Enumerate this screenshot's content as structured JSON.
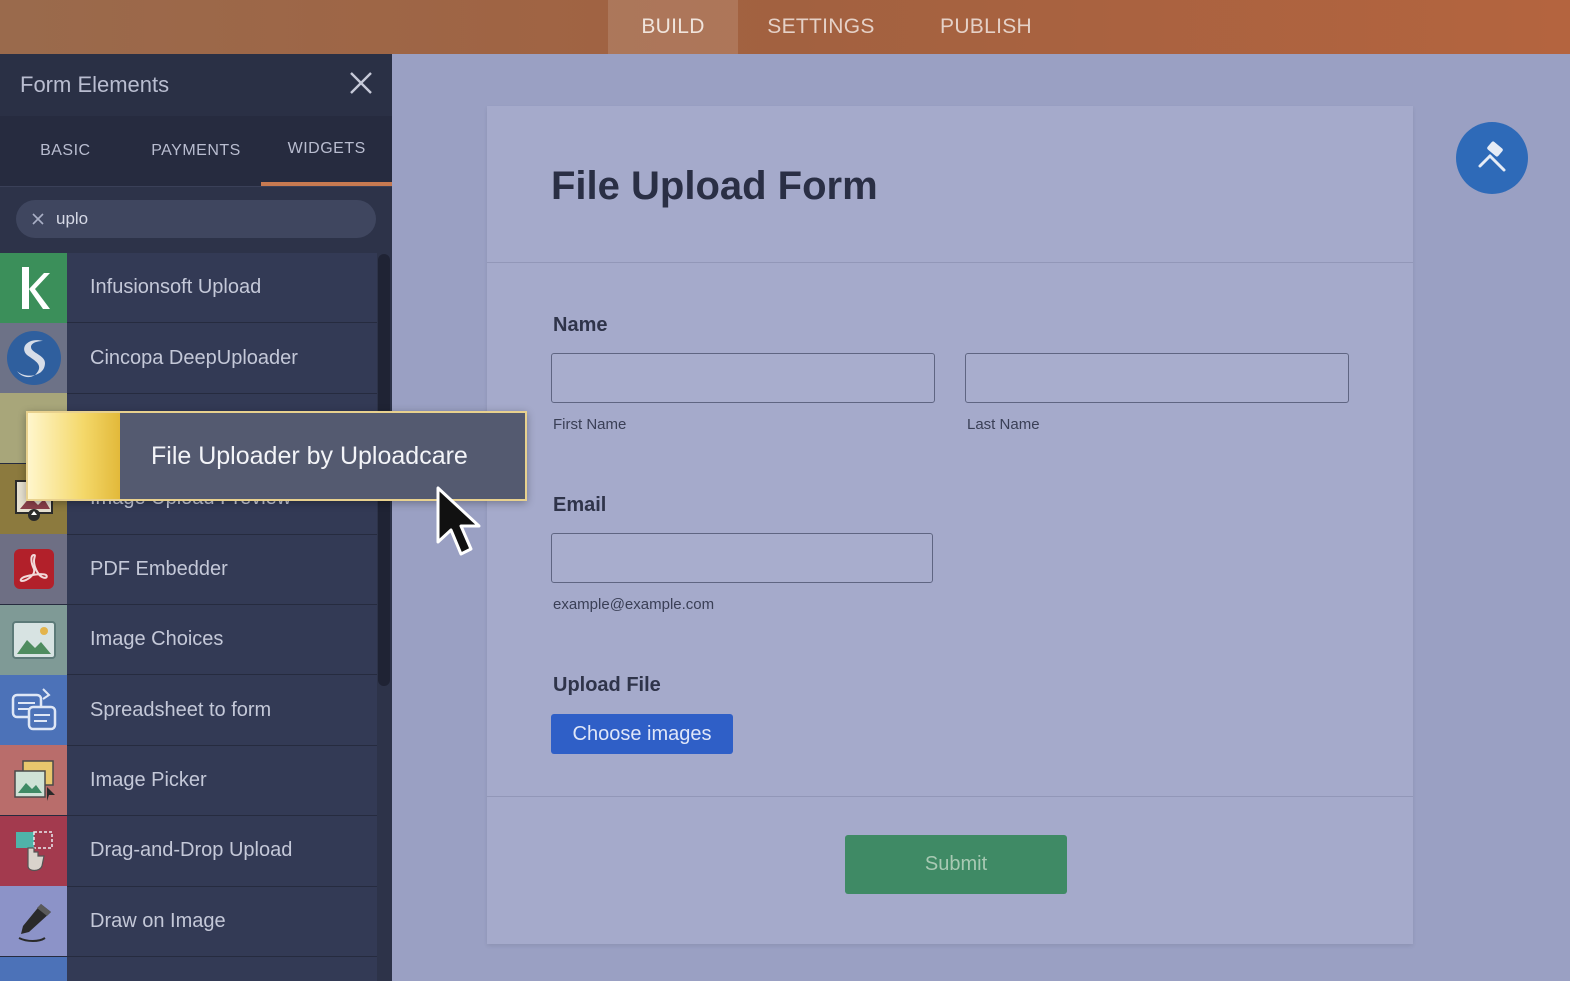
{
  "topnav": {
    "tabs": [
      "BUILD",
      "SETTINGS",
      "PUBLISH"
    ],
    "active": "BUILD"
  },
  "sidebar": {
    "title": "Form Elements",
    "tabs": [
      "BASIC",
      "PAYMENTS",
      "WIDGETS"
    ],
    "active_tab": "WIDGETS",
    "search_value": "uplo",
    "items": [
      {
        "label": "Infusionsoft Upload",
        "icon": "infusionsoft-icon"
      },
      {
        "label": "Cincopa DeepUploader",
        "icon": "cincopa-icon"
      },
      {
        "label": "",
        "icon": "uploadcare-icon"
      },
      {
        "label": "Image Upload Preview",
        "icon": "image-upload-preview-icon"
      },
      {
        "label": "PDF Embedder",
        "icon": "pdf-icon"
      },
      {
        "label": "Image Choices",
        "icon": "image-choices-icon"
      },
      {
        "label": "Spreadsheet to form",
        "icon": "spreadsheet-icon"
      },
      {
        "label": "Image Picker",
        "icon": "image-picker-icon"
      },
      {
        "label": "Drag-and-Drop Upload",
        "icon": "drag-drop-icon"
      },
      {
        "label": "Draw on Image",
        "icon": "draw-icon"
      }
    ]
  },
  "drag_ghost": {
    "label": "File Uploader by Uploadcare"
  },
  "form": {
    "title": "File Upload Form",
    "name_label": "Name",
    "first_name_sub": "First Name",
    "last_name_sub": "Last Name",
    "email_label": "Email",
    "email_sub": "example@example.com",
    "upload_label": "Upload File",
    "choose_button": "Choose images",
    "submit_button": "Submit"
  },
  "colors": {
    "topbar": "#a26140",
    "sidebar": "#2d3349",
    "canvas": "#9aa0c3",
    "accent": "#c77a51",
    "choose_button": "#2f5fc7",
    "submit_button": "#3f8a65",
    "designer_button": "#2e6ab8"
  }
}
